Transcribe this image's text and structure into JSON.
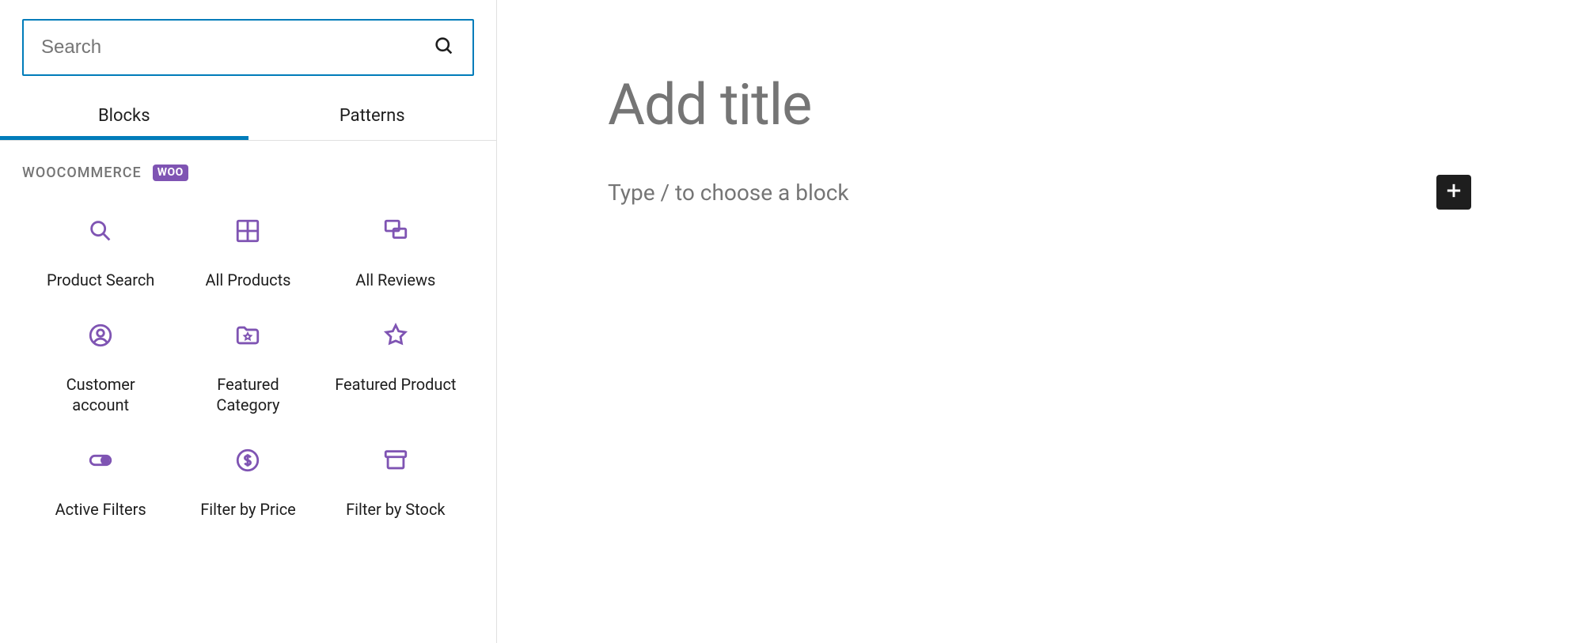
{
  "search": {
    "placeholder": "Search"
  },
  "tabs": {
    "blocks": "Blocks",
    "patterns": "Patterns"
  },
  "category": {
    "title": "WOOCOMMERCE",
    "badge": "WOO"
  },
  "blocks": [
    {
      "label": "Product Search"
    },
    {
      "label": "All Products"
    },
    {
      "label": "All Reviews"
    },
    {
      "label": "Customer account"
    },
    {
      "label": "Featured Category"
    },
    {
      "label": "Featured Product"
    },
    {
      "label": "Active Filters"
    },
    {
      "label": "Filter by Price"
    },
    {
      "label": "Filter by Stock"
    }
  ],
  "editor": {
    "title_placeholder": "Add title",
    "block_placeholder": "Type / to choose a block"
  },
  "colors": {
    "accent": "#007cba",
    "woo": "#7f54b3"
  }
}
